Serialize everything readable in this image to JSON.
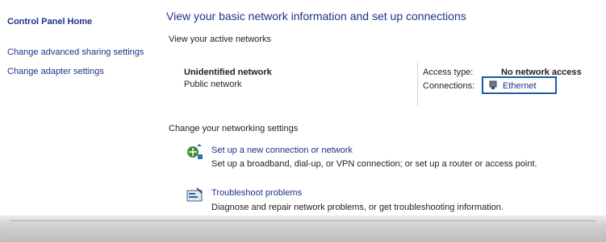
{
  "sidebar": {
    "home_link": "Control Panel Home",
    "advanced_sharing_link": "Change advanced sharing settings",
    "adapter_settings_link": "Change adapter settings"
  },
  "main": {
    "heading": "View your basic network information and set up connections",
    "active_networks_label": "View your active networks",
    "network": {
      "name": "Unidentified network",
      "type": "Public network"
    },
    "properties": {
      "access_type_label": "Access type:",
      "access_type_value": "No network access",
      "connections_label": "Connections:",
      "connections_value": "Ethernet"
    },
    "change_settings_label": "Change your networking settings",
    "tasks": [
      {
        "link": "Set up a new connection or network",
        "description": "Set up a broadband, dial-up, or VPN connection; or set up a router or access point.",
        "icon": "new-connection-icon"
      },
      {
        "link": "Troubleshoot problems",
        "description": "Diagnose and repair network problems, or get troubleshooting information.",
        "icon": "troubleshoot-icon"
      }
    ]
  },
  "colors": {
    "link": "#1e3287",
    "highlight_border": "#1a5aa8",
    "divider": "#d4d4d4"
  }
}
